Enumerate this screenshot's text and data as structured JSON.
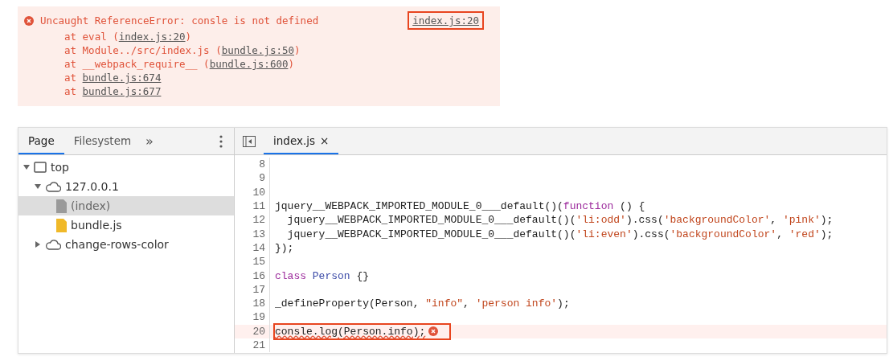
{
  "console_error": {
    "message": "Uncaught ReferenceError: consle is not defined",
    "source_link": {
      "text": "index.js:20",
      "highlighted": true
    },
    "stack": [
      {
        "at": "at",
        "before": "eval (",
        "link": "index.js:20",
        "after": ")"
      },
      {
        "at": "at",
        "before": "Module../src/index.js (",
        "link": "bundle.js:50",
        "after": ")"
      },
      {
        "at": "at",
        "before": "__webpack_require__ (",
        "link": "bundle.js:600",
        "after": ")"
      },
      {
        "at": "at",
        "link": "bundle.js:674"
      },
      {
        "at": "at",
        "link": "bundle.js:677"
      }
    ]
  },
  "sidebar": {
    "tabs": [
      {
        "label": "Page",
        "selected": true
      },
      {
        "label": "Filesystem",
        "selected": false
      }
    ],
    "more_tabs": "»",
    "tree": [
      {
        "label": "top",
        "kind": "frame",
        "expanded": true,
        "selected": false,
        "children": [
          {
            "label": "127.0.0.1",
            "kind": "origin",
            "expanded": true,
            "selected": false,
            "children": [
              {
                "label": "(index)",
                "kind": "document",
                "selected": true
              },
              {
                "label": "bundle.js",
                "kind": "script",
                "selected": false
              }
            ]
          },
          {
            "label": "change-rows-color",
            "kind": "origin",
            "expanded": false,
            "selected": false
          }
        ]
      }
    ]
  },
  "editor": {
    "tabs": [
      {
        "label": "index.js",
        "selected": true,
        "close": "×"
      }
    ],
    "lines": [
      {
        "number": "8"
      },
      {
        "number": "9"
      },
      {
        "number": "10"
      },
      {
        "number": "11",
        "tokens": [
          {
            "text": "jquery__WEBPACK_IMPORTED_MODULE_0___default()(",
            "kind": "plain"
          },
          {
            "text": "function",
            "kind": "keyword"
          },
          {
            "text": " () {",
            "kind": "plain"
          }
        ]
      },
      {
        "number": "12",
        "tokens": [
          {
            "text": "  jquery__WEBPACK_IMPORTED_MODULE_0___default()(",
            "kind": "plain"
          },
          {
            "text": "'li:odd'",
            "kind": "string"
          },
          {
            "text": ").css(",
            "kind": "plain"
          },
          {
            "text": "'backgroundColor'",
            "kind": "string"
          },
          {
            "text": ", ",
            "kind": "plain"
          },
          {
            "text": "'pink'",
            "kind": "string"
          },
          {
            "text": ");",
            "kind": "plain"
          }
        ]
      },
      {
        "number": "13",
        "tokens": [
          {
            "text": "  jquery__WEBPACK_IMPORTED_MODULE_0___default()(",
            "kind": "plain"
          },
          {
            "text": "'li:even'",
            "kind": "string"
          },
          {
            "text": ").css(",
            "kind": "plain"
          },
          {
            "text": "'backgroundColor'",
            "kind": "string"
          },
          {
            "text": ", ",
            "kind": "plain"
          },
          {
            "text": "'red'",
            "kind": "string"
          },
          {
            "text": ");",
            "kind": "plain"
          }
        ]
      },
      {
        "number": "14",
        "tokens": [
          {
            "text": "});",
            "kind": "plain"
          }
        ]
      },
      {
        "number": "15"
      },
      {
        "number": "16",
        "tokens": [
          {
            "text": "class",
            "kind": "keyword"
          },
          {
            "text": " Person",
            "kind": "class"
          },
          {
            "text": " {}",
            "kind": "plain"
          }
        ]
      },
      {
        "number": "17"
      },
      {
        "number": "18",
        "tokens": [
          {
            "text": "_defineProperty(Person, ",
            "kind": "plain"
          },
          {
            "text": "\"info\"",
            "kind": "string"
          },
          {
            "text": ", ",
            "kind": "plain"
          },
          {
            "text": "'person info'",
            "kind": "string"
          },
          {
            "text": ");",
            "kind": "plain"
          }
        ]
      },
      {
        "number": "19"
      },
      {
        "number": "20",
        "error": true,
        "highlighted": true,
        "tokens": [
          {
            "text": "consle.log(Person.info);",
            "kind": "plain"
          }
        ]
      },
      {
        "number": "21"
      }
    ]
  }
}
